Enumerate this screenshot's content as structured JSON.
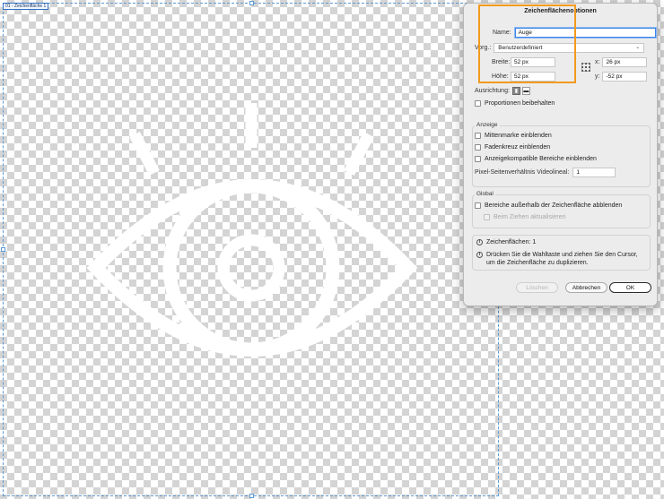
{
  "artboard": {
    "label": "01 - Zeichenfläche 1"
  },
  "dialog": {
    "title": "Zeichenflächenoptionen",
    "name_label": "Name:",
    "name_value": "Auge",
    "preset_label": "Vorg.:",
    "preset_value": "Benutzerdefiniert",
    "width_label": "Breite:",
    "width_value": "52 px",
    "height_label": "Höhe:",
    "height_value": "52 px",
    "x_label": "x:",
    "x_value": "26 px",
    "y_label": "y:",
    "y_value": "-52 px",
    "orientation_label": "Ausrichtung:",
    "keep_proportions": "Proportionen beibehalten",
    "display": {
      "title": "Anzeige",
      "center_mark": "Mittenmarke einblenden",
      "crosshair": "Fadenkreuz einblenden",
      "video_safe": "Anzeigekompatible Bereiche einblenden",
      "pixel_ratio_label": "Pixel-Seitenverhältnis Videolineal:",
      "pixel_ratio_value": "1"
    },
    "global": {
      "title": "Global",
      "fade_outside": "Bereiche außerhalb der Zeichenfläche abblenden",
      "update_drag": "Beim Ziehen aktualisieren"
    },
    "info": {
      "artboards": "Zeichenflächen: 1",
      "hint": "Drücken Sie die Wahltaste und ziehen Sie den Cursor, um die Zeichenfläche zu duplizieren."
    },
    "buttons": {
      "delete": "Löschen",
      "cancel": "Abbrechen",
      "ok": "OK"
    }
  },
  "colors": {
    "highlight": "#f39a1e",
    "artboard_border": "#5b9bd5",
    "focus": "#3b84e8"
  },
  "icons": {
    "eye": "eye-icon",
    "reference_point": "reference-point-icon",
    "portrait": "portrait-orientation-icon",
    "landscape": "landscape-orientation-icon",
    "info": "info-icon"
  }
}
